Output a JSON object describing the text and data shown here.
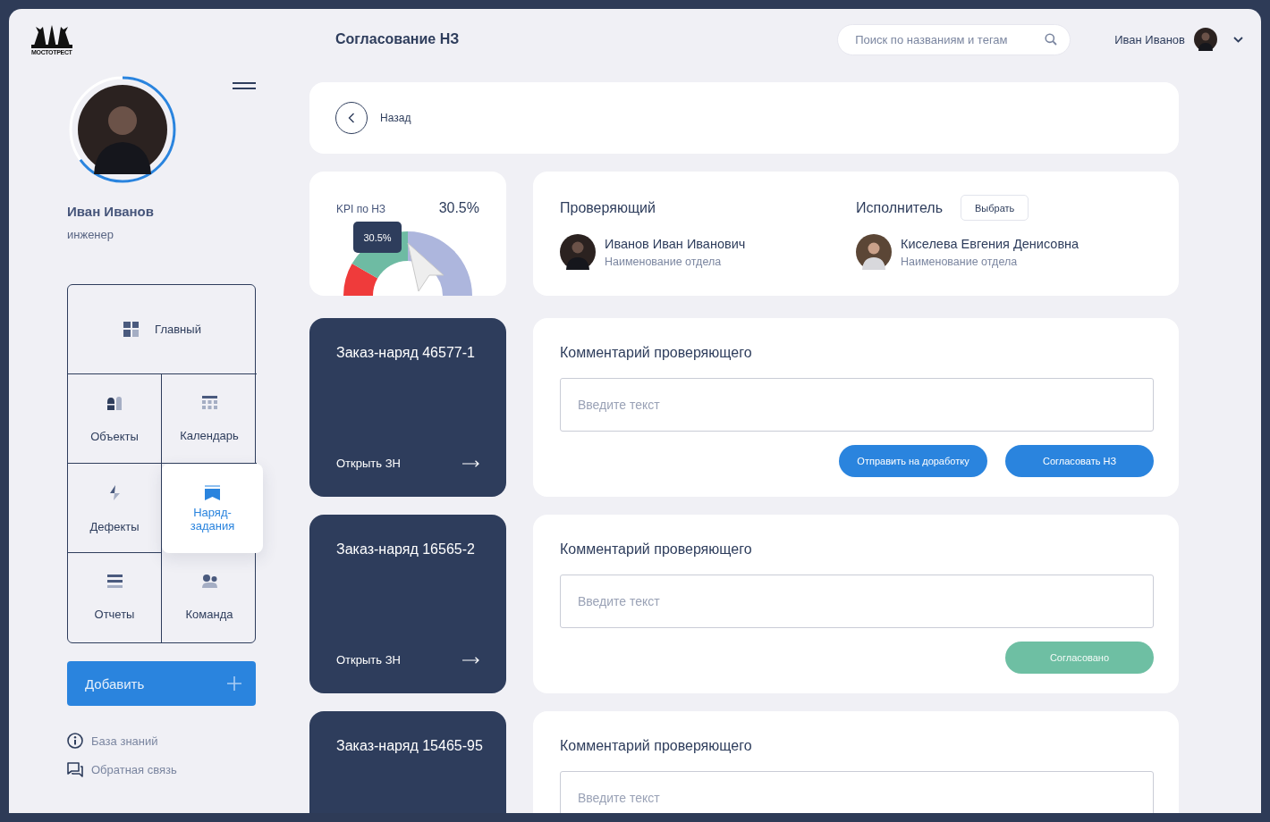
{
  "logo": {
    "text": "МОСТОТРЕСТ"
  },
  "profile": {
    "name": "Иван Иванов",
    "role": "инженер",
    "level": 0.65
  },
  "page_title": "Согласование НЗ",
  "search": {
    "placeholder": "Поиск по названиям и тегам"
  },
  "header_user": {
    "name": "Иван Иванов"
  },
  "menu": [
    {
      "label": "Главный",
      "selected": false
    },
    {
      "label": "Объекты",
      "selected": false
    },
    {
      "label": "Календарь",
      "selected": false
    },
    {
      "label": "Дефекты",
      "selected": false
    },
    {
      "label": "Наряд-задания",
      "selected": true
    },
    {
      "label": "Отчеты",
      "selected": false
    },
    {
      "label": "Команда",
      "selected": false
    }
  ],
  "add_button": {
    "label": "Добавить"
  },
  "links": [
    {
      "label": "База знаний"
    },
    {
      "label": "Обратная связь"
    }
  ],
  "back": {
    "label": "Назад"
  },
  "kpi": {
    "title": "KPI по НЗ",
    "value": "30.5%",
    "tooltip": "30.5%"
  },
  "reviewer": {
    "heading": "Проверяющий",
    "name": "Иванов Иван Иванович",
    "department": "Наименование отдела"
  },
  "executor": {
    "heading": "Исполнитель",
    "button": "Выбрать",
    "name": "Киселева Евгения Денисовна",
    "department": "Наименование отдела"
  },
  "orders": [
    {
      "title": "Заказ-наряд 46577-1",
      "link": "Открыть ЗН",
      "comment": {
        "title": "Комментарий проверяющего",
        "placeholder": "Введите текст",
        "buttons": [
          {
            "label": "Отправить на доработку",
            "kind": "primary"
          },
          {
            "label": "Согласовать НЗ",
            "kind": "primary"
          }
        ]
      }
    },
    {
      "title": "Заказ-наряд 16565-2",
      "link": "Открыть ЗН",
      "comment": {
        "title": "Комментарий проверяющего",
        "placeholder": "Введите текст",
        "buttons": [
          {
            "label": "Согласовано",
            "kind": "approved"
          }
        ]
      }
    },
    {
      "title": "Заказ-наряд 15465-95",
      "comment": {
        "title": "Комментарий проверяющего",
        "placeholder": "Введите текст"
      }
    }
  ]
}
